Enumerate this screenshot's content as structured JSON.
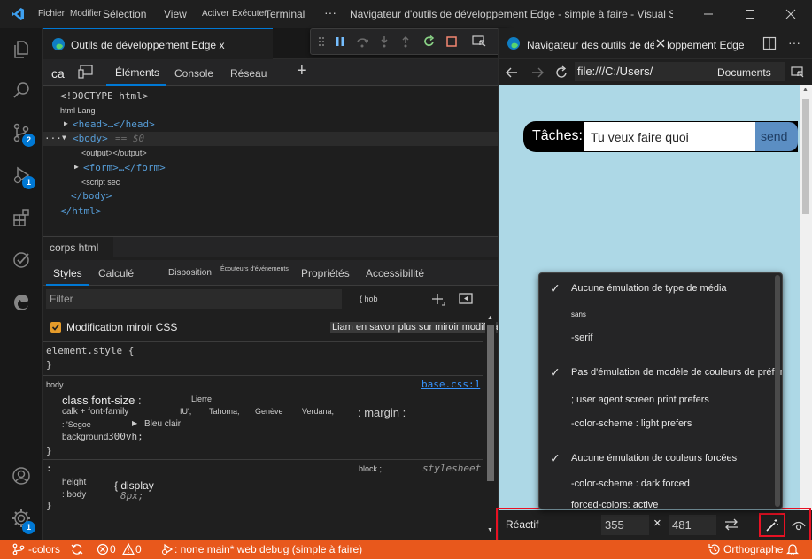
{
  "titlebar": {
    "menu": [
      "Fichier",
      "Modifier",
      "Sélection",
      "View",
      "Activer",
      "Exécuter",
      "Terminal",
      "···"
    ],
    "window_title": "Navigateur d'outils de développement Edge - simple à faire - Visual Stud..."
  },
  "activity": {
    "scm_badge": "2",
    "debug_badge": "1",
    "accounts_badge": "1"
  },
  "left_panel": {
    "tab_title": "Outils de développement Edge x",
    "debug_toolbar_icons": [
      "grip-icon",
      "pause-icon",
      "step-over-icon",
      "step-into-icon",
      "step-out-icon",
      "restart-icon",
      "stop-icon",
      "inspect-icon"
    ],
    "devtools_tabs": {
      "ca": "ca",
      "elements": "Éléments",
      "console": "Console",
      "network": "Réseau",
      "add": "+"
    },
    "dom": {
      "doctype": "<!DOCTYPE html>",
      "html_lang": "html Lang",
      "head": "<head>…</head>",
      "body_prefix": "···",
      "body": "<body>",
      "body_eq": "== $0",
      "output": "<output></output>",
      "form": "<form>…</form>",
      "script": "<script sec",
      "body_close": "</body>",
      "html_close": "</html>"
    },
    "breadcrumb": "corps html",
    "style_tabs": {
      "styles": "Styles",
      "computed": "Calculé",
      "layout": "Disposition",
      "listeners": "Écouteurs d'événements",
      "props": "Propriétés",
      "a11y": "Accessibilité"
    },
    "filter": {
      "placeholder": "Filter",
      "hov": "{ hob"
    },
    "mirror": {
      "label": "Modification miroir CSS",
      "link": "Liam en savoir plus sur miroir modification"
    },
    "rules": {
      "element_style": "element.style {",
      "element_close": "}",
      "body_selector": "body",
      "body_source": "base.css:1",
      "class_font_size": "class font-size",
      "colon": ":",
      "lierre": "Lierre",
      "calk": "calk + font-family",
      "iu": "IU',",
      "tahoma": "Tahoma,",
      "geneve": "Genève",
      "verdana": "Verdana,",
      "margin": ": margin :",
      "segoe": ": 'Segoe",
      "bleu": "Bleu clair",
      "background": "background",
      "vh": "300vh;",
      "body_close": "}",
      "second_colon": ":",
      "block": "block ;",
      "stylesheet": "stylesheet",
      "height": "height",
      "display": "{ display",
      "body_line": ": body",
      "px": "8px;",
      "last_close": "}"
    }
  },
  "right_panel": {
    "tab_title": "Navigateur des outils de développement Edge",
    "url": "file:///C:/Users/",
    "url_extra": "Documents",
    "todo": {
      "label": "Tâches:",
      "placeholder": "Tu veux faire quoi",
      "send": "send"
    },
    "popup": [
      {
        "checked": true,
        "text": "Aucune émulation de type de média"
      },
      {
        "checked": false,
        "text": "sans",
        "small": true
      },
      {
        "checked": false,
        "text": "-serif"
      },
      {
        "checked": true,
        "text": "Pas d'émulation de modèle de couleurs de préférence"
      },
      {
        "checked": false,
        "text": "; user agent screen print prefers"
      },
      {
        "checked": false,
        "text": "-color-scheme : light prefers"
      },
      {
        "checked": true,
        "text": "Aucune émulation de couleurs forcées"
      },
      {
        "checked": false,
        "text": "-color-scheme : dark forced"
      },
      {
        "checked": false,
        "text": "forced-colors: active"
      }
    ],
    "device_toolbar": {
      "mode": "Réactif",
      "width": "355",
      "times": "×",
      "height": "481"
    }
  },
  "statusbar": {
    "colors": "-colors",
    "errors": "0",
    "warnings": "0",
    "branch": ": none main* web debug (simple à faire)",
    "spell": "Orthographe"
  },
  "colors": {
    "accent": "#0078d4",
    "status": "#e8581c",
    "highlight": "#e81123"
  }
}
